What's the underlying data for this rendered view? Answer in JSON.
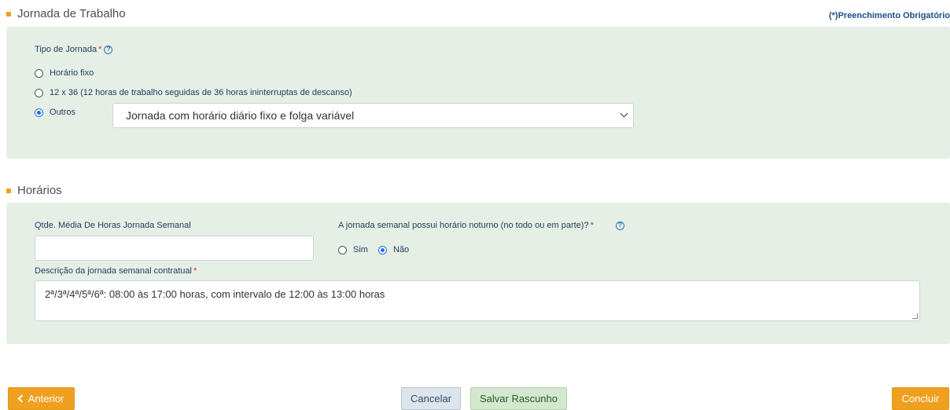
{
  "section1": {
    "title": "Jornada de Trabalho",
    "required_note": "(*)Preenchimento Obrigatório",
    "tipo_label": "Tipo de Jornada",
    "required_star": "*",
    "options": [
      {
        "label": "Horário fixo",
        "checked": false
      },
      {
        "label": "12 x 36 (12 horas de trabalho seguidas de 36 horas ininterruptas de descanso)",
        "checked": false
      },
      {
        "label": "Outros",
        "checked": true
      }
    ],
    "select_value": "Jornada com horário diário fixo e folga variável"
  },
  "section2": {
    "title": "Horários",
    "qtde_label": "Qtde. Média De Horas Jornada Semanal",
    "qtde_value": "",
    "noturno_label": "A jornada semanal possui horário noturno (no todo ou em parte)?",
    "noturno_options": [
      {
        "label": "Sim",
        "checked": false
      },
      {
        "label": "Não",
        "checked": true
      }
    ],
    "descricao_label": "Descrição da jornada semanal contratual",
    "descricao_value": "2ª/3ª/4ª/5ª/6ª: 08:00 às 17:00 horas, com  intervalo de 12:00 às 13:00 horas"
  },
  "buttons": {
    "anterior": "Anterior",
    "cancelar": "Cancelar",
    "salvar": "Salvar Rascunho",
    "concluir": "Concluir"
  },
  "colors": {
    "accent": "#f0a020",
    "panel": "#e6efe6",
    "required": "#d9262c",
    "link": "#1a4f8b"
  },
  "icons": {
    "help": "help-circle-icon",
    "radio_checked": "radio-checked-icon",
    "back": "chevron-left-icon",
    "dropdown": "chevron-down-icon"
  }
}
